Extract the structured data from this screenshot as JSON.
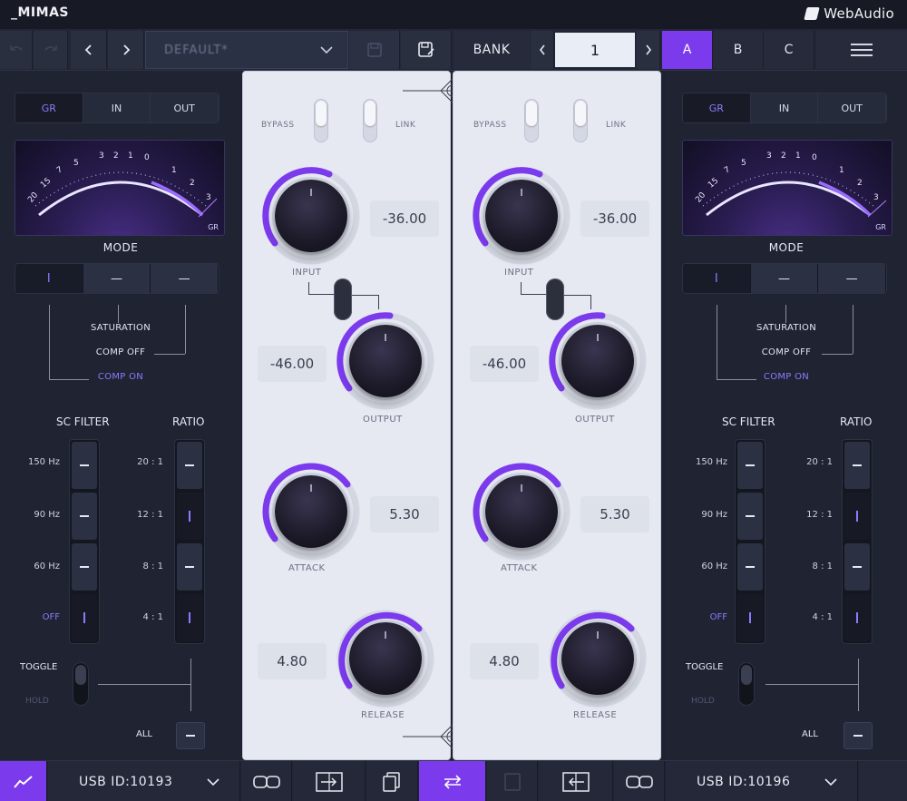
{
  "app": {
    "title": "_MIMAS",
    "brand": "WebAudio"
  },
  "toolbar": {
    "preset_value": "DEFAULT*",
    "bank_label": "BANK",
    "bank_number": "1",
    "slots": [
      "A",
      "B",
      "C"
    ],
    "active_slot": "A"
  },
  "colors": {
    "accent": "#7c3aed",
    "panel_light": "#e6e9f2",
    "background": "#1d2130"
  },
  "left": {
    "tabs": [
      "GR",
      "IN",
      "OUT"
    ],
    "active_tab": "GR",
    "meter": {
      "scale": [
        "20",
        "15",
        "7",
        "5",
        "3",
        "2",
        "1",
        "0",
        "1",
        "2",
        "3"
      ],
      "unit": "GR"
    },
    "mode_label": "MODE",
    "mode_buttons": [
      "I",
      "—",
      "—"
    ],
    "mode_options": [
      "SATURATION",
      "COMP OFF",
      "COMP ON"
    ],
    "sc_filter_label": "SC FILTER",
    "ratio_label": "RATIO",
    "sc_filter_rows": [
      "150 Hz",
      "90 Hz",
      "60 Hz",
      "OFF"
    ],
    "ratio_rows": [
      "20 : 1",
      "12 : 1",
      "8 : 1",
      "4 : 1"
    ],
    "sc_filter_selected": "OFF",
    "ratio_selected": [
      "12 : 1",
      "4 : 1"
    ],
    "toggle_label": "TOGGLE",
    "hold_label": "HOLD",
    "all_label": "ALL"
  },
  "right": {
    "tabs": [
      "GR",
      "IN",
      "OUT"
    ],
    "active_tab": "GR",
    "meter": {
      "scale": [
        "20",
        "15",
        "7",
        "5",
        "3",
        "2",
        "1",
        "0",
        "1",
        "2",
        "3"
      ],
      "unit": "GR"
    },
    "mode_label": "MODE",
    "mode_buttons": [
      "I",
      "—",
      "—"
    ],
    "mode_options": [
      "SATURATION",
      "COMP OFF",
      "COMP ON"
    ],
    "sc_filter_label": "SC FILTER",
    "ratio_label": "RATIO",
    "sc_filter_rows": [
      "150 Hz",
      "90 Hz",
      "60 Hz",
      "OFF"
    ],
    "ratio_rows": [
      "20 : 1",
      "12 : 1",
      "8 : 1",
      "4 : 1"
    ],
    "sc_filter_selected": "OFF",
    "ratio_selected": [
      "12 : 1",
      "4 : 1"
    ],
    "toggle_label": "TOGGLE",
    "hold_label": "HOLD",
    "all_label": "ALL"
  },
  "channel_left": {
    "bypass_label": "BYPASS",
    "link_label": "LINK",
    "input_label": "INPUT",
    "input_value": "-36.00",
    "output_label": "OUTPUT",
    "output_value": "-46.00",
    "attack_label": "ATTACK",
    "attack_value": "5.30",
    "release_label": "RELEASE",
    "release_value": "4.80"
  },
  "channel_right": {
    "bypass_label": "BYPASS",
    "link_label": "LINK",
    "input_label": "INPUT",
    "input_value": "-36.00",
    "output_label": "OUTPUT",
    "output_value": "-46.00",
    "attack_label": "ATTACK",
    "attack_value": "5.30",
    "release_label": "RELEASE",
    "release_value": "4.80"
  },
  "bottom": {
    "usb_left": "USB ID:10193",
    "usb_right": "USB ID:10196"
  }
}
